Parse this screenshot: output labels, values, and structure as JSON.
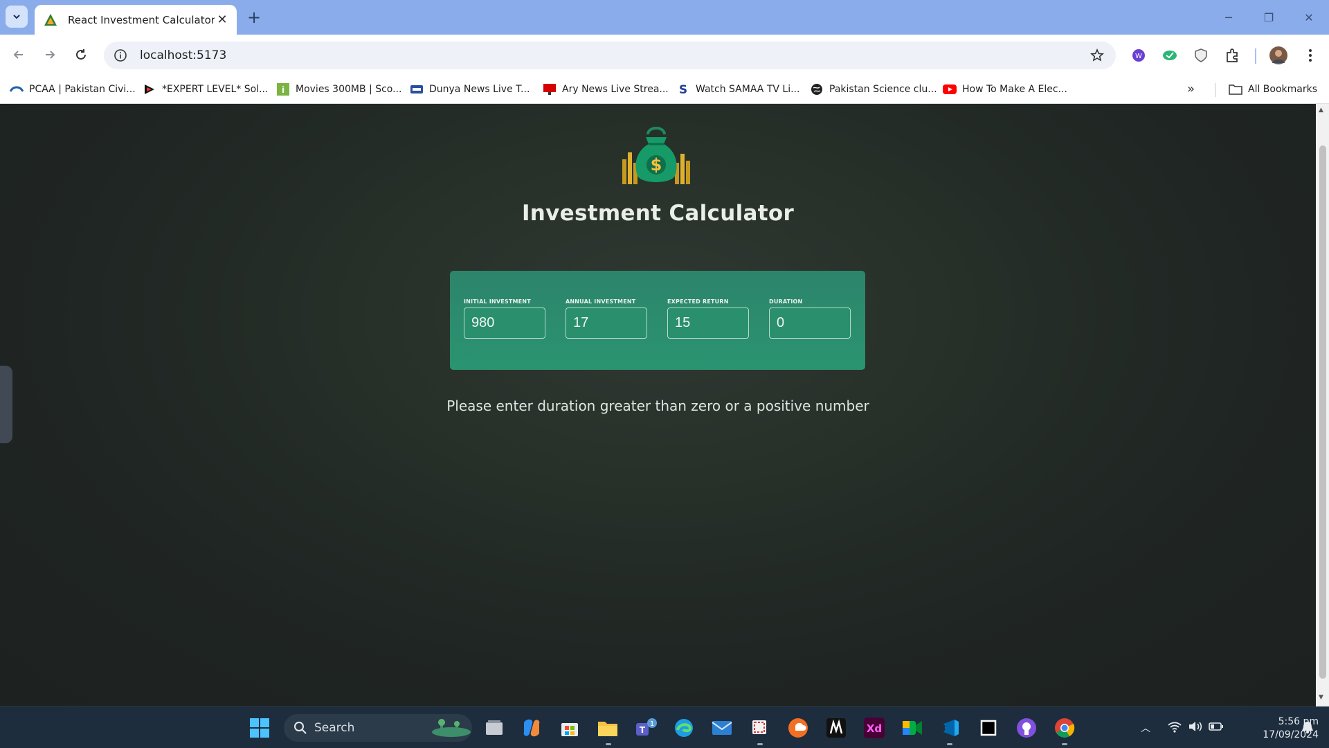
{
  "browser": {
    "tab_title": "React Investment Calculator",
    "url": "localhost:5173",
    "bookmarks": [
      {
        "label": "PCAA | Pakistan Civi...",
        "icon": "pcaa-icon"
      },
      {
        "label": "*EXPERT LEVEL* Sol...",
        "icon": "expert-icon"
      },
      {
        "label": "Movies 300MB | Sco...",
        "icon": "movies-icon"
      },
      {
        "label": "Dunya News Live T...",
        "icon": "dunya-icon"
      },
      {
        "label": "Ary News Live Strea...",
        "icon": "ary-icon"
      },
      {
        "label": "Watch SAMAA TV Li...",
        "icon": "samaa-icon"
      },
      {
        "label": "Pakistan Science clu...",
        "icon": "globe-icon"
      },
      {
        "label": "How To Make A Elec...",
        "icon": "youtube-icon"
      }
    ],
    "all_bookmarks_label": "All Bookmarks"
  },
  "app": {
    "title": "Investment Calculator",
    "inputs": [
      {
        "label": "Initial Investment",
        "value": "980"
      },
      {
        "label": "Annual Investment",
        "value": "17"
      },
      {
        "label": "Expected Return",
        "value": "15"
      },
      {
        "label": "Duration",
        "value": "0"
      }
    ],
    "message": "Please enter duration greater than zero or a positive number"
  },
  "taskbar": {
    "search_label": "Search",
    "teams_badge": "1",
    "time": "5:56 pm",
    "date": "17/09/2024"
  },
  "colors": {
    "card": "#2a8f6c",
    "page_bg": "#242b28",
    "tabstrip": "#8aacea"
  }
}
